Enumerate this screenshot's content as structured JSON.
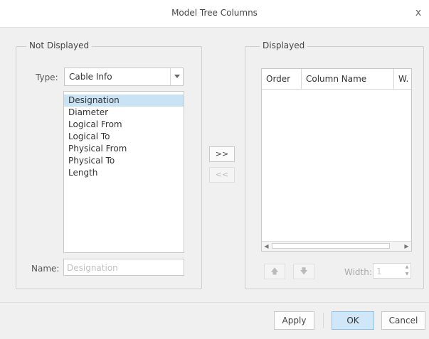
{
  "dialog": {
    "title": "Model Tree Columns",
    "close_glyph": "x"
  },
  "not_displayed": {
    "group_title": "Not Displayed",
    "type_label": "Type:",
    "type_value": "Cable Info",
    "items": [
      "Designation",
      "Diameter",
      "Logical From",
      "Logical To",
      "Physical From",
      "Physical To",
      "Length"
    ],
    "selected_index": 0,
    "name_label": "Name:",
    "name_placeholder": "Designation"
  },
  "transfer": {
    "add_label": ">>",
    "remove_label": "<<"
  },
  "displayed": {
    "group_title": "Displayed",
    "columns": [
      "Order",
      "Column Name",
      "W."
    ],
    "width_label": "Width:",
    "width_value": "1"
  },
  "buttons": {
    "apply": "Apply",
    "ok": "OK",
    "cancel": "Cancel"
  },
  "colors": {
    "accent": "#cfe7f8",
    "selection": "#c9e3f5"
  }
}
